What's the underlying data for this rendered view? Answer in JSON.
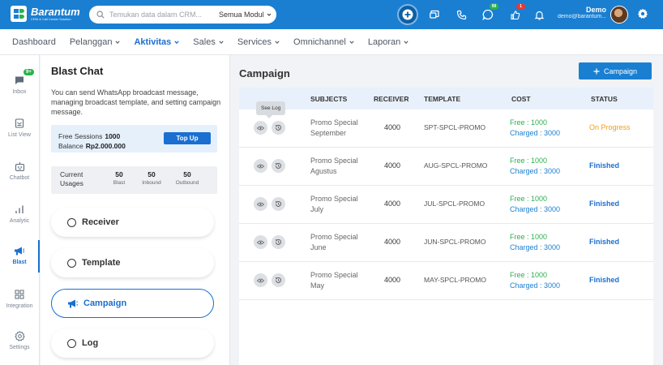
{
  "header": {
    "logo_name": "Barantum",
    "logo_tagline": "CRM & Call Center Solution",
    "search_placeholder": "Temukan data dalam CRM...",
    "search_module": "Semua Modul",
    "badges": {
      "whatsapp": "99",
      "notif": "1"
    },
    "user_name": "Demo",
    "user_email": "demo@barantum..."
  },
  "topnav": [
    {
      "label": "Dashboard",
      "has_dropdown": false,
      "active": false
    },
    {
      "label": "Pelanggan",
      "has_dropdown": true,
      "active": false
    },
    {
      "label": "Aktivitas",
      "has_dropdown": true,
      "active": true
    },
    {
      "label": "Sales",
      "has_dropdown": true,
      "active": false
    },
    {
      "label": "Services",
      "has_dropdown": true,
      "active": false
    },
    {
      "label": "Omnichannel",
      "has_dropdown": true,
      "active": false
    },
    {
      "label": "Laporan",
      "has_dropdown": true,
      "active": false
    }
  ],
  "rail": {
    "inbox_badge": "9+",
    "items": [
      {
        "label": "Inbox",
        "icon": "inbox-icon"
      },
      {
        "label": "List View",
        "icon": "list-view-icon"
      },
      {
        "label": "Chatbot",
        "icon": "chatbot-icon"
      },
      {
        "label": "Analytic",
        "icon": "analytic-icon"
      },
      {
        "label": "Blast",
        "icon": "megaphone-icon"
      },
      {
        "label": "Integration",
        "icon": "integration-icon"
      },
      {
        "label": "Settings",
        "icon": "settings-icon"
      }
    ]
  },
  "panel": {
    "title": "Blast Chat",
    "description": "You can send WhatsApp broadcast message, managing broadcast template, and setting campaign message.",
    "free_sessions_label": "Free Sessions",
    "free_sessions_value": "1000",
    "balance_label": "Balance",
    "balance_value": "Rp2.000.000",
    "topup_label": "Top Up",
    "usage_label": "Current Usages",
    "usage": [
      {
        "value": "50",
        "label": "Blast"
      },
      {
        "value": "50",
        "label": "Inbound"
      },
      {
        "value": "50",
        "label": "Outbound"
      }
    ],
    "menu": [
      {
        "label": "Receiver",
        "active": false
      },
      {
        "label": "Template",
        "active": false
      },
      {
        "label": "Campaign",
        "active": true
      },
      {
        "label": "Log",
        "active": false
      }
    ]
  },
  "main": {
    "title": "Campaign",
    "add_button": "Campaign",
    "tooltip": "See Log",
    "columns": [
      "SUBJECTS",
      "RECEIVER",
      "TEMPLATE",
      "COST",
      "STATUS"
    ],
    "rows": [
      {
        "subject_1": "Promo Special",
        "subject_2": "September",
        "receiver": "4000",
        "template": "SPT-SPCL-PROMO",
        "free": "Free : 1000",
        "charged": "Charged : 3000",
        "status": "On Progress"
      },
      {
        "subject_1": "Promo Special",
        "subject_2": "Agustus",
        "receiver": "4000",
        "template": "AUG-SPCL-PROMO",
        "free": "Free : 1000",
        "charged": "Charged : 3000",
        "status": "Finished"
      },
      {
        "subject_1": "Promo Special",
        "subject_2": "July",
        "receiver": "4000",
        "template": "JUL-SPCL-PROMO",
        "free": "Free : 1000",
        "charged": "Charged : 3000",
        "status": "Finished"
      },
      {
        "subject_1": "Promo Special",
        "subject_2": "June",
        "receiver": "4000",
        "template": "JUN-SPCL-PROMO",
        "free": "Free : 1000",
        "charged": "Charged : 3000",
        "status": "Finished"
      },
      {
        "subject_1": "Promo Special",
        "subject_2": "May",
        "receiver": "4000",
        "template": "MAY-SPCL-PROMO",
        "free": "Free : 1000",
        "charged": "Charged : 3000",
        "status": "Finished"
      }
    ]
  },
  "colors": {
    "brand": "#1a7fd1",
    "status_progress": "#f39c12",
    "status_finished": "#1a6fd1",
    "free": "#2eae50"
  }
}
